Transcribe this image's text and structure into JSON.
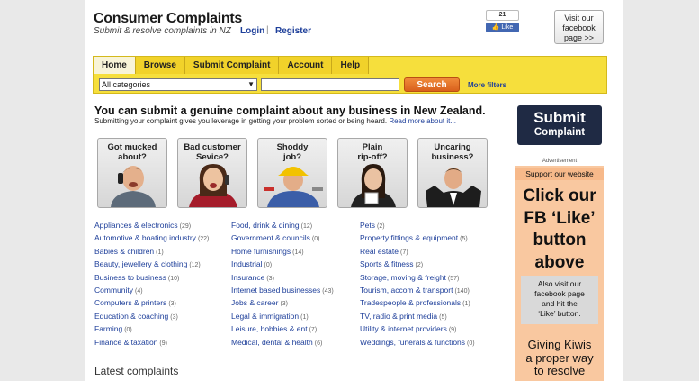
{
  "header": {
    "title": "Consumer Complaints",
    "tagline": "Submit & resolve complaints in NZ",
    "login": "Login",
    "separator": "|",
    "register": "Register"
  },
  "facebook": {
    "like_count": "21",
    "like_label": "Like",
    "visit_line1": "Visit our",
    "visit_line2": "facebook",
    "visit_line3": "page >>",
    "brand_color": "#4267b2"
  },
  "nav": {
    "tabs": [
      "Home",
      "Browse",
      "Submit Complaint",
      "Account",
      "Help"
    ],
    "active_tab": "Home",
    "category_select": "All categories",
    "search_value": "",
    "search_button": "Search",
    "more_filters": "More filters",
    "bar_color": "#f6df3c",
    "button_color": "#e8762a"
  },
  "intro": {
    "heading": "You can submit a genuine complaint about any business in New Zealand.",
    "sub": "Submitting your complaint gives you leverage in getting your problem sorted or being heard.",
    "read_more": "Read more about it..."
  },
  "cards": [
    {
      "line1": "Got mucked",
      "line2": "about?"
    },
    {
      "line1": "Bad customer",
      "line2": "Sevice?"
    },
    {
      "line1": "Shoddy",
      "line2": "job?"
    },
    {
      "line1": "Plain",
      "line2": "rip-off?"
    },
    {
      "line1": "Uncaring",
      "line2": "business?"
    }
  ],
  "categories": {
    "col1": [
      {
        "name": "Appliances & electronics",
        "count": "(29)"
      },
      {
        "name": "Automotive & boating industry",
        "count": "(22)"
      },
      {
        "name": "Babies & children",
        "count": "(1)"
      },
      {
        "name": "Beauty, jewellery & clothing",
        "count": "(12)"
      },
      {
        "name": "Business to business",
        "count": "(10)"
      },
      {
        "name": "Community",
        "count": "(4)"
      },
      {
        "name": "Computers & printers",
        "count": "(3)"
      },
      {
        "name": "Education & coaching",
        "count": "(3)"
      },
      {
        "name": "Farming",
        "count": "(0)"
      },
      {
        "name": "Finance & taxation",
        "count": "(9)"
      }
    ],
    "col2": [
      {
        "name": "Food, drink & dining",
        "count": "(12)"
      },
      {
        "name": "Government & councils",
        "count": "(0)"
      },
      {
        "name": "Home furnishings",
        "count": "(14)"
      },
      {
        "name": "Industrial",
        "count": "(0)"
      },
      {
        "name": "Insurance",
        "count": "(3)"
      },
      {
        "name": "Internet based businesses",
        "count": "(43)"
      },
      {
        "name": "Jobs & career",
        "count": "(3)"
      },
      {
        "name": "Legal & immigration",
        "count": "(1)"
      },
      {
        "name": "Leisure, hobbies & ent",
        "count": "(7)"
      },
      {
        "name": "Medical, dental & health",
        "count": "(6)"
      }
    ],
    "col3": [
      {
        "name": "Pets",
        "count": "(2)"
      },
      {
        "name": "Property fittings & equipment",
        "count": "(5)"
      },
      {
        "name": "Real estate",
        "count": "(7)"
      },
      {
        "name": "Sports & fitness",
        "count": "(2)"
      },
      {
        "name": "Storage, moving & freight",
        "count": "(57)"
      },
      {
        "name": "Tourism, accom & transport",
        "count": "(140)"
      },
      {
        "name": "Tradespeople & professionals",
        "count": "(1)"
      },
      {
        "name": "TV, radio & print media",
        "count": "(5)"
      },
      {
        "name": "Utility & internet providers",
        "count": "(9)"
      },
      {
        "name": "Weddings, funerals & functions",
        "count": "(0)"
      }
    ]
  },
  "latest": {
    "heading": "Latest complaints"
  },
  "sidebar": {
    "submit_line1": "Submit",
    "submit_line2": "Complaint",
    "ad_label": "Advertisement",
    "support": "Support our website",
    "big1": "Click our",
    "big2": "FB ‘Like’",
    "big3": "button",
    "big4": "above",
    "also1": "Also visit our",
    "also2": "facebook page",
    "also3": "and hit the",
    "also4": "‘Like’ button.",
    "giving1": "Giving Kiwis",
    "giving2": "a proper way",
    "giving3": "to resolve"
  }
}
